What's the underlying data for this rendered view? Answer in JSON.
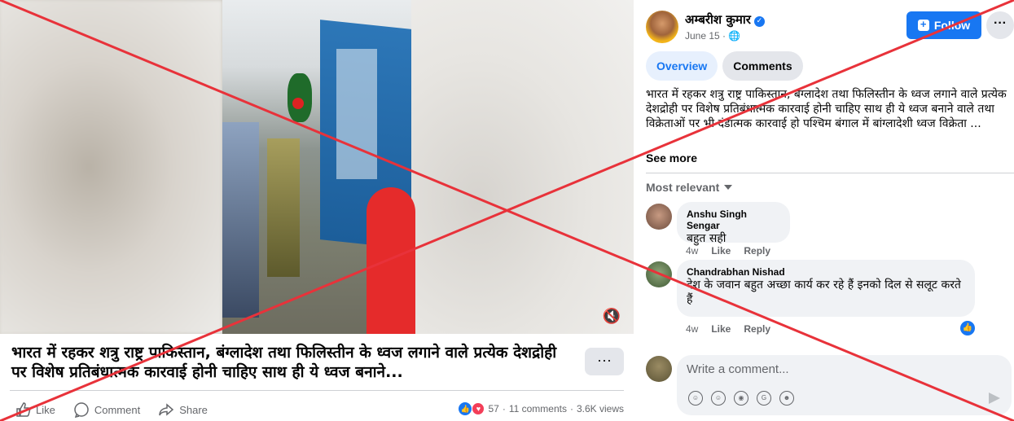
{
  "video": {
    "mute_icon": "volume-muted-icon"
  },
  "post": {
    "caption": "भारत में रहकर शत्रु राष्ट्र पाकिस्तान, बंग्लादेश तथा फिलिस्तीन के ध्वज लगाने वाले प्रत्येक देशद्रोही पर विशेष प्रतिबंधात्मक कारवाई होनी चाहिए साथ ही ये ध्वज बनाने...",
    "more_label": "···",
    "actions": {
      "like": "Like",
      "comment": "Comment",
      "share": "Share"
    },
    "stats": {
      "reactions": "57",
      "comments": "11 comments",
      "views": "3.6K views",
      "separator": "·"
    }
  },
  "panel": {
    "author": "अम्बरीश कुमार",
    "date": "June 15 ·",
    "follow_label": "Follow",
    "more_label": "···",
    "tabs": [
      "Overview",
      "Comments"
    ],
    "post_text": "भारत में रहकर शत्रु राष्ट्र पाकिस्तान, बंग्लादेश तथा फिलिस्तीन के ध्वज लगाने वाले प्रत्येक देशद्रोही पर विशेष प्रतिबंधात्मक कारवाई होनी चाहिए साथ ही ये ध्वज बनाने वाले तथा विक्रेताओं पर भी दंडात्मक कारवाई हो पश्चिम बंगाल में बांग्लादेशी ध्वज विक्रेता ...",
    "see_more": "See more",
    "sort_label": "Most relevant",
    "comments": [
      {
        "name": "Anshu Singh Sengar",
        "text": "बहुत सही",
        "time": "4w",
        "like": "Like",
        "reply": "Reply"
      },
      {
        "name": "Chandrabhan Nishad",
        "text": "देश के जवान बहुत अच्छा कार्य कर रहे हैं इनको दिल से सलूट करते हैं",
        "time": "4w",
        "like": "Like",
        "reply": "Reply"
      }
    ],
    "compose_placeholder": "Write a comment..."
  },
  "colors": {
    "accent": "#1877f2",
    "cross": "#e8323a"
  }
}
